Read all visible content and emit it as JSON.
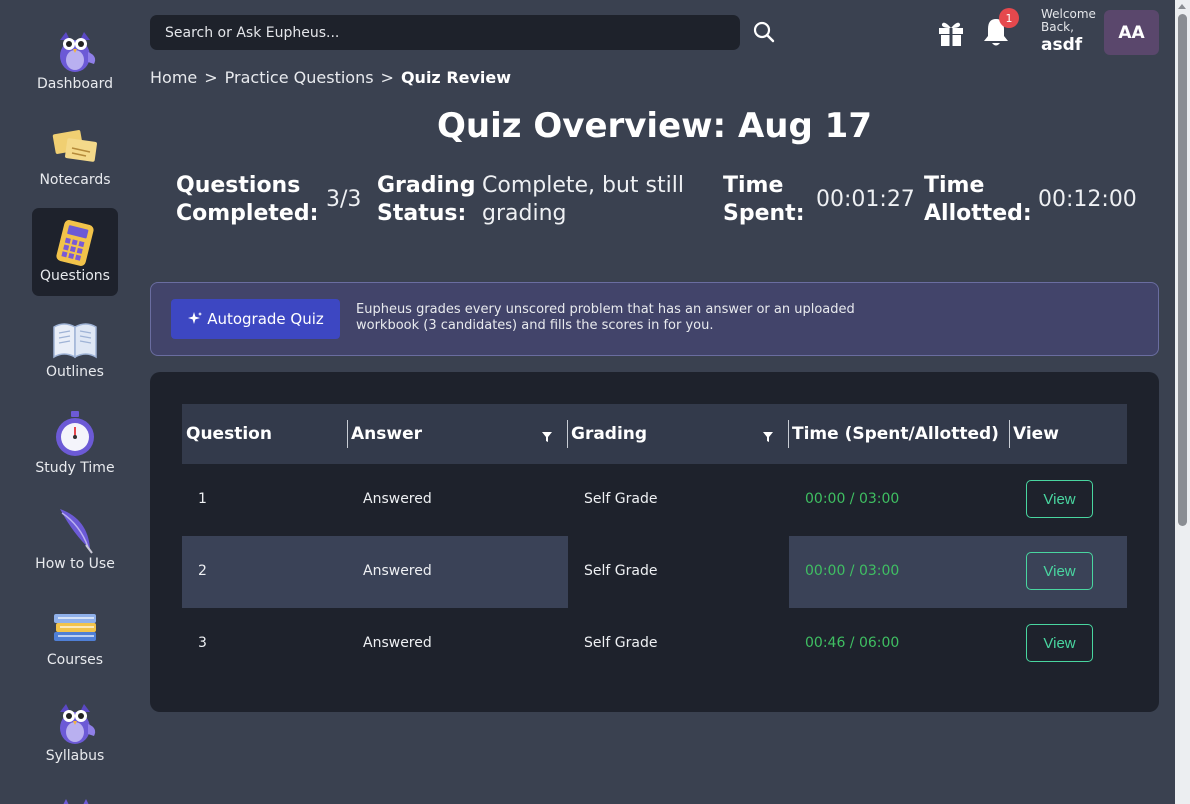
{
  "sidebar": {
    "items": [
      {
        "label": "Dashboard",
        "icon": "owl-icon"
      },
      {
        "label": "Notecards",
        "icon": "notecards-icon"
      },
      {
        "label": "Questions",
        "icon": "calculator-icon",
        "active": true
      },
      {
        "label": "Outlines",
        "icon": "open-book-icon"
      },
      {
        "label": "Study Time",
        "icon": "stopwatch-icon"
      },
      {
        "label": "How to Use",
        "icon": "quill-icon"
      },
      {
        "label": "Courses",
        "icon": "books-stack-icon"
      },
      {
        "label": "Syllabus",
        "icon": "owl-icon"
      }
    ]
  },
  "header": {
    "search_placeholder": "Search or Ask Eupheus...",
    "notification_count": "1",
    "welcome": "Welcome Back,",
    "username": "asdf",
    "avatar_initials": "AA"
  },
  "breadcrumb": {
    "home": "Home",
    "practice": "Practice Questions",
    "current": "Quiz Review",
    "separator": ">"
  },
  "overview": {
    "title": "Quiz Overview: Aug 17",
    "stats": {
      "completed_label_1": "Questions",
      "completed_label_2": "Completed:",
      "completed_value": "3/3",
      "grading_label_1": "Grading",
      "grading_label_2": "Status:",
      "grading_value_1": "Complete, but still",
      "grading_value_2": "grading",
      "spent_label_1": "Time",
      "spent_label_2": "Spent:",
      "spent_value": "00:01:27",
      "allotted_label_1": "Time",
      "allotted_label_2": "Allotted:",
      "allotted_value": "00:12:00"
    }
  },
  "autograde": {
    "button_label": "Autograde Quiz",
    "description": "Eupheus grades every unscored problem that has an answer or an uploaded workbook (3 candidates) and fills the scores in for you."
  },
  "table": {
    "headers": {
      "question": "Question",
      "answer": "Answer",
      "grading": "Grading",
      "time": "Time (Spent/Allotted)",
      "view": "View"
    },
    "rows": [
      {
        "question": "1",
        "answer": "Answered",
        "grading": "Self Grade",
        "time": "00:00 / 03:00",
        "view": "View"
      },
      {
        "question": "2",
        "answer": "Answered",
        "grading": "Self Grade",
        "time": "00:00 / 03:00",
        "view": "View"
      },
      {
        "question": "3",
        "answer": "Answered",
        "grading": "Self Grade",
        "time": "00:46 / 06:00",
        "view": "View"
      }
    ]
  },
  "colors": {
    "background": "#3a4150",
    "card": "#1e222c",
    "accent": "#3d47c2",
    "time_green": "#3fbf62",
    "view_border": "#49d6a0",
    "badge": "#e5484d"
  }
}
